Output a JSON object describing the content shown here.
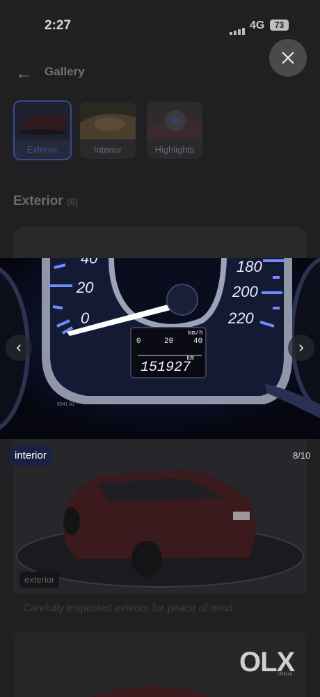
{
  "status_bar": {
    "time": "2:27",
    "network": "4G",
    "battery": "73"
  },
  "header": {
    "title": "Gallery"
  },
  "tabs": [
    {
      "label": "Exterior",
      "active": true
    },
    {
      "label": "Interior",
      "active": false
    },
    {
      "label": "Highlights",
      "active": false
    }
  ],
  "section": {
    "title": "Exterior",
    "count": "(6)"
  },
  "photo": {
    "odometer": "151927",
    "odometer_unit": "km",
    "speed_unit": "km/h",
    "trip_a": "0",
    "trip_mid": "20",
    "trip_right": "40",
    "gauge_labels": [
      "40",
      "20",
      "0",
      "180",
      "200",
      "220"
    ],
    "plate_text": "6941 A1"
  },
  "viewer": {
    "category_tag": "interior",
    "counter": "8/10"
  },
  "card": {
    "tag": "exterior",
    "caption": "Carefully inspected exterior for peace of mind"
  },
  "brand": {
    "logo_text": "OLX",
    "logo_sub": "INDIA"
  },
  "colors": {
    "accent": "#3b4a8a",
    "tag_bg": "#1a2244",
    "gauge_glow": "#3a5cff"
  }
}
